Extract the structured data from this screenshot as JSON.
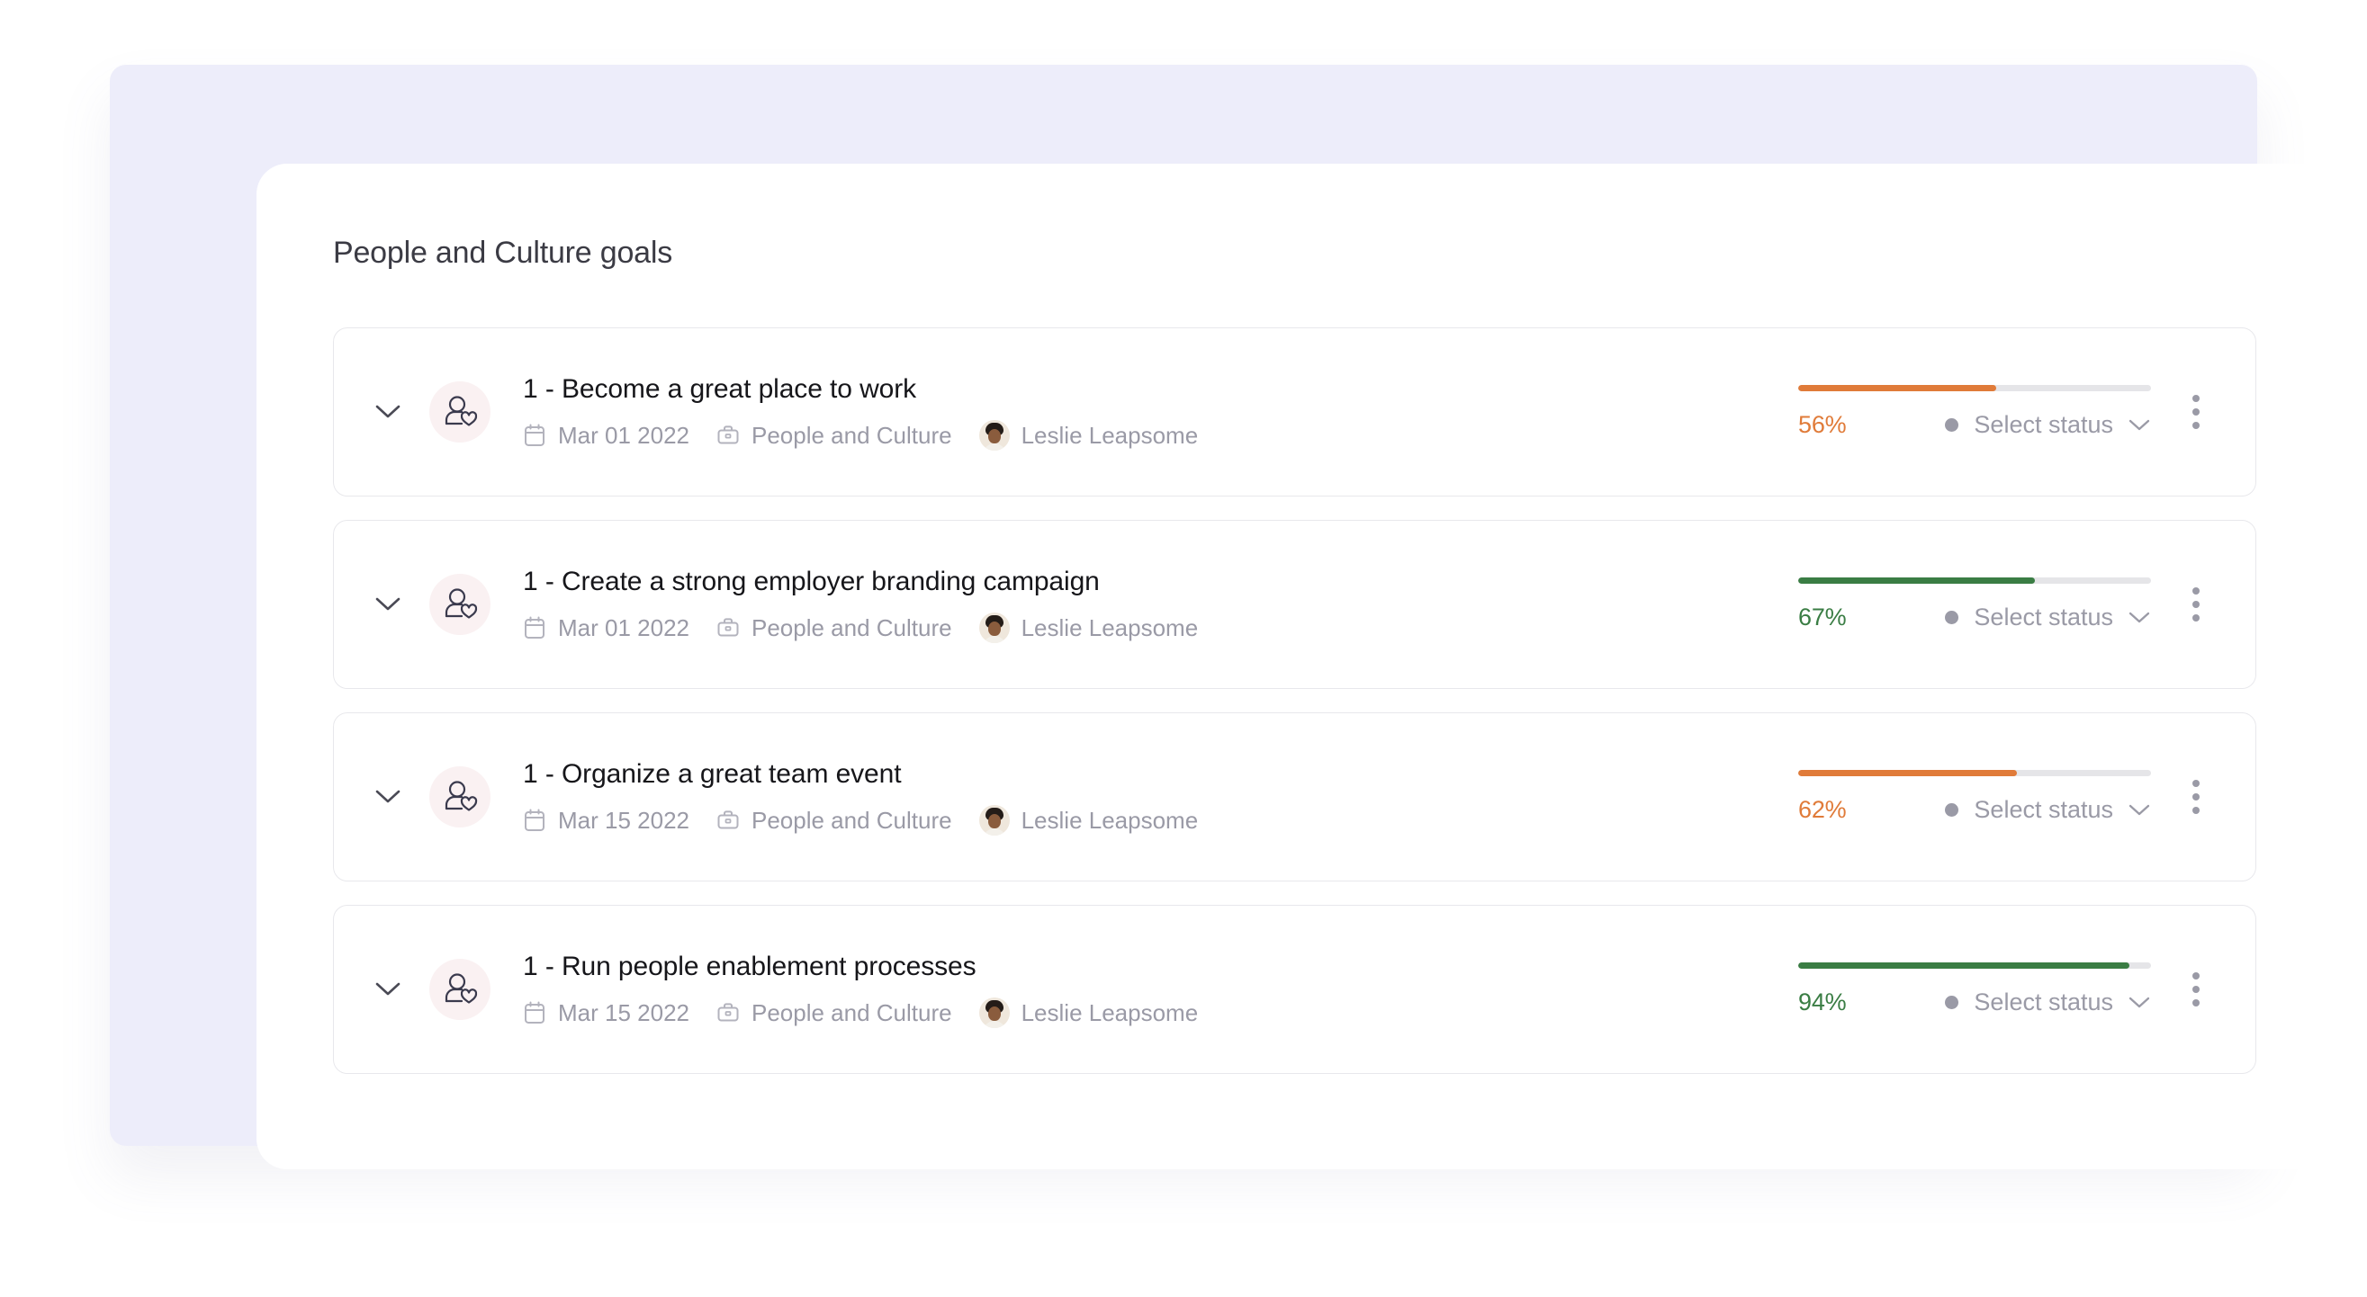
{
  "card": {
    "title": "People and Culture goals"
  },
  "colors": {
    "frame_background": "#ededfa",
    "card_background": "#ffffff",
    "progress_orange": "#e07b39",
    "progress_green": "#3a7d44",
    "progress_track": "#e5e5e8",
    "muted_text": "#9a9aa6",
    "title_text": "#3b3b44",
    "goal_text": "#16161a",
    "avatar_badge_background": "#faf1f2"
  },
  "icons": {
    "expand": "chevron-down-icon",
    "goal_avatar": "person-heart-icon",
    "date": "calendar-icon",
    "group": "briefcase-icon",
    "owner": "user-photo-avatar",
    "status_caret": "chevron-down-icon",
    "menu": "kebab-menu-icon"
  },
  "goals": [
    {
      "name": "1 - Become a great place to work",
      "date": "Mar 01 2022",
      "group": "People and Culture",
      "owner": "Leslie Leapsome",
      "progress_label": "56%",
      "progress_value": 56,
      "progress_color": "#e07b39",
      "status_label": "Select status"
    },
    {
      "name": "1 - Create a strong employer branding campaign",
      "date": "Mar 01 2022",
      "group": "People and Culture",
      "owner": "Leslie Leapsome",
      "progress_label": "67%",
      "progress_value": 67,
      "progress_color": "#3a7d44",
      "status_label": "Select status"
    },
    {
      "name": "1 - Organize a great team event",
      "date": "Mar 15 2022",
      "group": "People and Culture",
      "owner": "Leslie Leapsome",
      "progress_label": "62%",
      "progress_value": 62,
      "progress_color": "#e07b39",
      "status_label": "Select status"
    },
    {
      "name": "1 - Run people enablement processes",
      "date": "Mar 15 2022",
      "group": "People and Culture",
      "owner": "Leslie Leapsome",
      "progress_label": "94%",
      "progress_value": 94,
      "progress_color": "#3a7d44",
      "status_label": "Select status"
    }
  ]
}
